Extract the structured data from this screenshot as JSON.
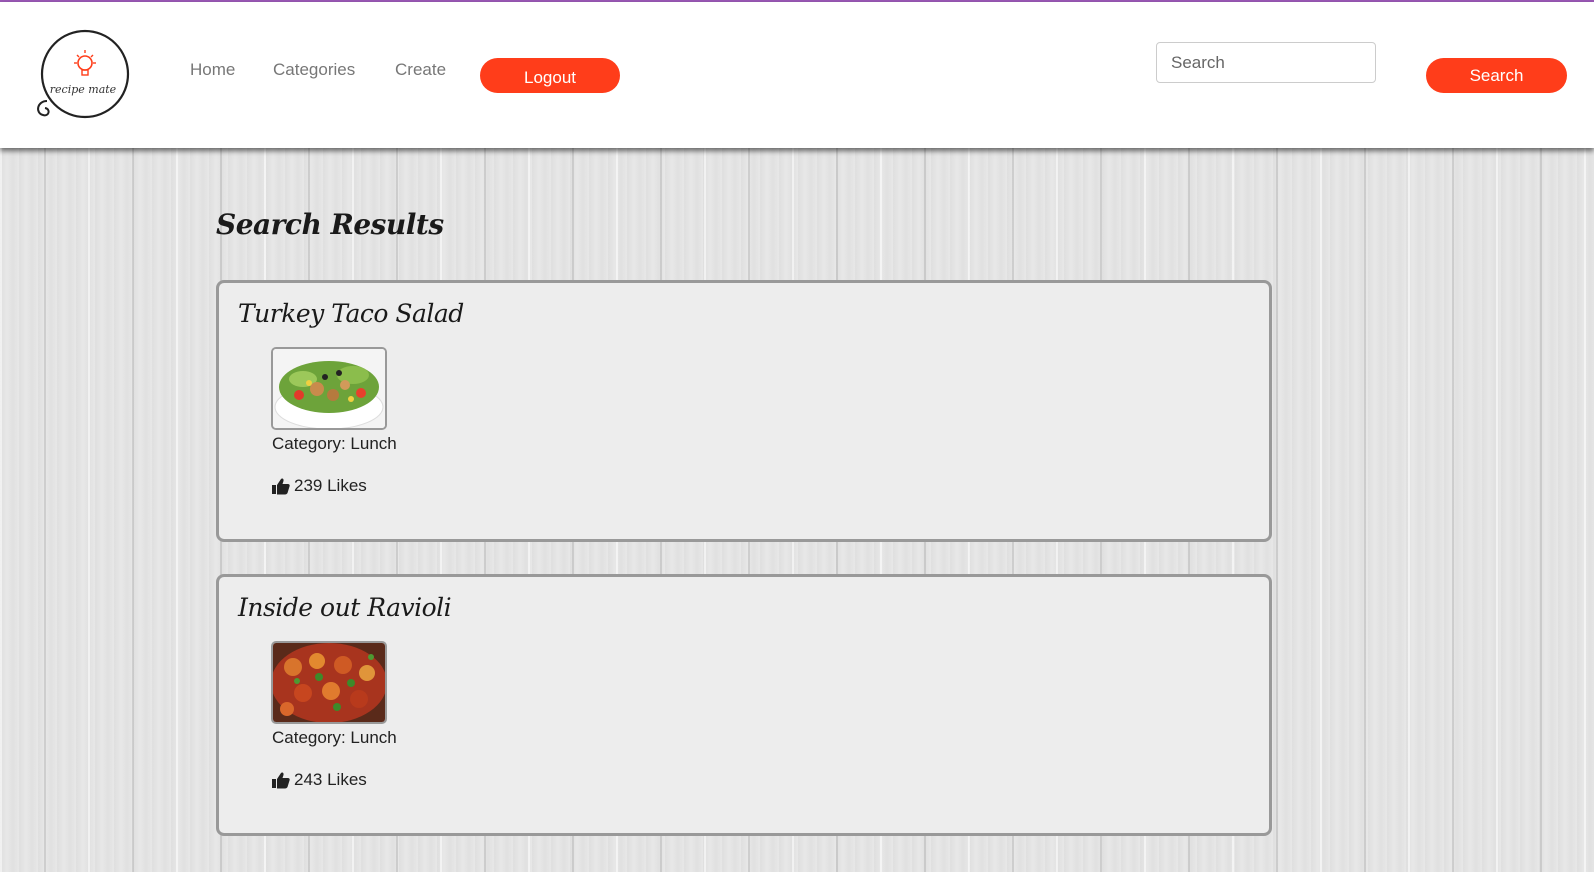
{
  "header": {
    "logo_text": "recipe mate",
    "nav": [
      {
        "label": "Home"
      },
      {
        "label": "Categories"
      },
      {
        "label": "Create"
      }
    ],
    "logout_label": "Logout",
    "search": {
      "placeholder": "Search",
      "value": ""
    },
    "search_button_label": "Search"
  },
  "main": {
    "title": "Search Results",
    "results": [
      {
        "title": "Turkey Taco Salad",
        "category": "Category: Lunch",
        "likes": "239 Likes"
      },
      {
        "title": "Inside out Ravioli",
        "category": "Category: Lunch",
        "likes": "243 Likes"
      }
    ]
  },
  "colors": {
    "accent": "#ff3d1a",
    "top_border": "#9b59b6",
    "card_bg": "#ededed",
    "card_border": "#999999"
  },
  "icons": [
    "lightbulb-icon",
    "thumbs-up-icon"
  ]
}
